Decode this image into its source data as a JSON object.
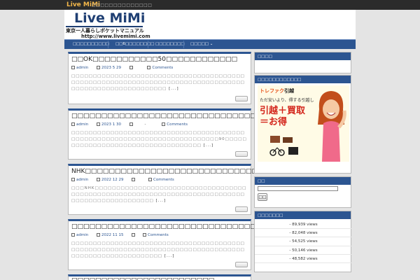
{
  "topbar": {
    "brand": "Live MiMi",
    "tagline": "□□□□□□□□□□□□□□"
  },
  "header": {
    "title": "Live MiMi",
    "subtitle": "東京一人暮らしポケットマニュアル",
    "url": "http://www.livemimi.com"
  },
  "nav": {
    "items": [
      "□□□□□□□□□□",
      "□□6□□□□□□□□",
      "□□□□□□□□",
      "□□□□□"
    ]
  },
  "posts": [
    {
      "title": "□□OK□□□□□□□□□□□50□□□□□□□□□□□□",
      "author": "admin",
      "date": "2023 5 29",
      "comments": "Comments",
      "body": "□□□□□□□□□□□□□□□□□□□□□□□□□□□□□□□□□□□□□□□□□□□□□□□□□□□□□□□□□□□□□□□□□□□□□□□□□□□□□□□□□□□□□□□□□□□□□□□□□□□□□□",
      "more": "[...]"
    },
    {
      "title": "□□□□□□□□□□□□□□□□□□□□□□□□□□□□□□□□□",
      "author": "admin",
      "date": "2023 1 30",
      "sep": "-",
      "comments": "Comments",
      "body": "□□□□□□□□□□□□□□□□□□□□□□□□□□□□□□□□□□□□□□□□□□□□□□□□□□□□□□□□□□□□□□□□□□□□□□□□□□90□□□□□□□□□□□□□□□□□□□□□□□□□□□□□□□□□□□",
      "more": "[...]"
    },
    {
      "title": "NHK□□□□□□□□□□□□□□□□□□□□□□□□□□□□□□",
      "author": "admin",
      "date": "2022 12 29",
      "comments": "Comments",
      "body": "□□□NHK□□□□□□□□□□□□□□□□□□□□□□□□□□□□□□□□□□□□□□□□□□□□□□□□□□□□□□□□□□□□□□□□□□□□□□□□□□□□□□□□□□□□□□□□□□□□□□",
      "more": "[...]"
    },
    {
      "title": "□□□□□□□□□□□□□□□□□□□□□□□□□□□□□□□□",
      "author": "admin",
      "date": "2022 11 15",
      "comments": "Comments",
      "body": "□□□□□□□□□□□□□□□□□□□□□□□□□□□□□□□□□□□□□□□□□□□□□□□□□□□□□□□□□□□□□□□□□□□□□□□□□□□□□□□□□□□□□□□□□□□□□□□□□□□□□",
      "more": "[...]"
    },
    {
      "title": "□□□□□□□□□□□□□□□□□□□□□□□□"
    }
  ],
  "sidebar": {
    "box1": {
      "title": "□□□□"
    },
    "ad": {
      "title": "□□□□□□□□□□□□",
      "brand_mark": "トレファク",
      "brand_name": "引越",
      "copy": "ただ安いより、得する引越し",
      "line1": "引越＋買取",
      "line2": "＝お得"
    },
    "search": {
      "title": "□□",
      "button": "□□"
    },
    "popular": {
      "title": "□□□□□□□",
      "items": [
        "- 89,939 views",
        "- 82,048 views",
        "- 54,525 views",
        "- 50,146 views",
        "- 48,582 views"
      ]
    }
  },
  "colors": {
    "accent": "#2c5591",
    "brand": "#f2b64a",
    "ad_red": "#d3251b"
  }
}
